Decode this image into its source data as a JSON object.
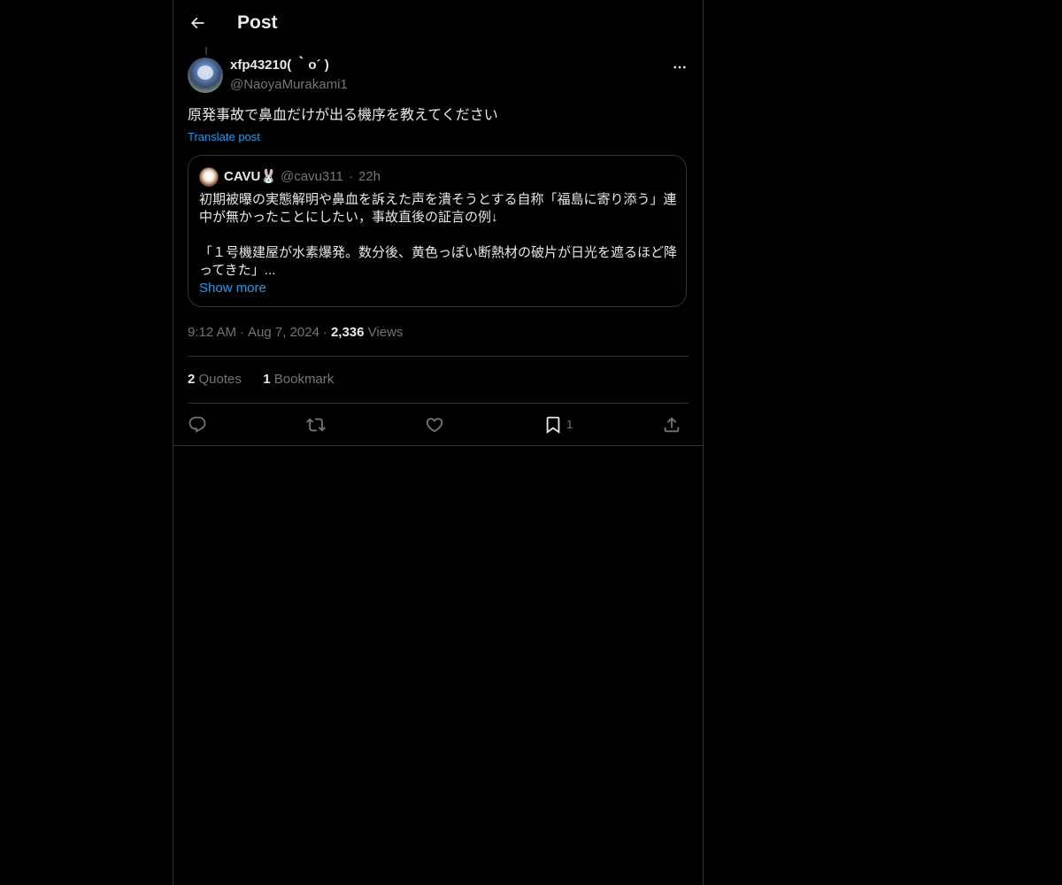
{
  "header": {
    "title": "Post",
    "back_icon": "arrow-left-icon"
  },
  "post": {
    "author": {
      "display_name": "xfp43210( ｀o´ )",
      "handle": "@NaoyaMurakami1"
    },
    "text": "原発事故で鼻血だけが出る機序を教えてください",
    "translate_label": "Translate post",
    "quote": {
      "display_name": "CAVU",
      "name_emoji": "🐰",
      "handle": "@cavu311",
      "separator": "·",
      "time": "22h",
      "lines": [
        "初期被曝の実態解明や鼻血を訴えた声を潰そうとする自称「福島に寄り添う」連",
        "中が無かったことにしたい，事故直後の証言の例↓",
        "",
        "「１号機建屋が水素爆発。数分後、黄色っぽい断熱材の破片が日光を遮るほど降",
        "ってきた」..."
      ],
      "show_more": "Show more"
    },
    "meta": {
      "time": "9:12 AM",
      "date": "Aug 7, 2024",
      "views_count": "2,336",
      "views_label": "Views",
      "separator": "·"
    },
    "stats": {
      "quotes_count": "2",
      "quotes_label": "Quotes",
      "bookmarks_count": "1",
      "bookmarks_label": "Bookmark"
    },
    "actions": {
      "reply_icon": "reply-icon",
      "repost_icon": "repost-icon",
      "like_icon": "heart-icon",
      "bookmark_icon": "bookmark-icon",
      "bookmark_count": "1",
      "share_icon": "share-icon"
    }
  },
  "colors": {
    "background": "#000000",
    "text": "#e7e9ea",
    "muted": "#71767b",
    "accent": "#1d9bf0",
    "border": "#2f3336"
  }
}
